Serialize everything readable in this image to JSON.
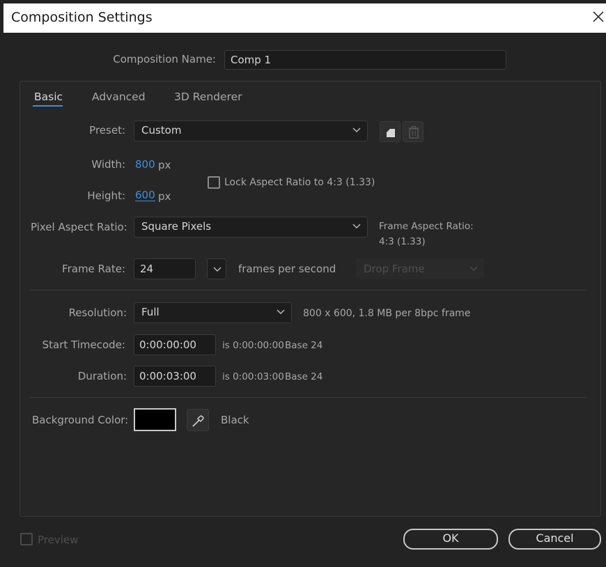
{
  "dialog": {
    "title": "Composition Settings"
  },
  "name": {
    "label": "Composition Name:",
    "value": "Comp 1"
  },
  "tabs": [
    {
      "label": "Basic",
      "active": true
    },
    {
      "label": "Advanced",
      "active": false
    },
    {
      "label": "3D Renderer",
      "active": false
    }
  ],
  "preset": {
    "label": "Preset:",
    "value": "Custom"
  },
  "width": {
    "label": "Width:",
    "value": "800",
    "unit": "px"
  },
  "height": {
    "label": "Height:",
    "value": "600",
    "unit": "px"
  },
  "lock_aspect": {
    "label": "Lock Aspect Ratio to 4:3 (1.33)",
    "checked": false
  },
  "pixel_aspect": {
    "label": "Pixel Aspect Ratio:",
    "value": "Square Pixels",
    "frame_aspect_label": "Frame Aspect Ratio:",
    "frame_aspect_value": "4:3 (1.33)"
  },
  "frame_rate": {
    "label": "Frame Rate:",
    "value": "24",
    "unit": "frames per second",
    "drop_frame": "Drop Frame"
  },
  "resolution": {
    "label": "Resolution:",
    "value": "Full",
    "info": "800 x 600, 1.8 MB per 8bpc frame"
  },
  "start_timecode": {
    "label": "Start Timecode:",
    "value": "0:00:00:00",
    "is_text": "is 0:00:00:00",
    "base": "Base 24"
  },
  "duration": {
    "label": "Duration:",
    "value": "0:00:03:00",
    "is_text": "is 0:00:03:00",
    "base": "Base 24"
  },
  "background": {
    "label": "Background Color:",
    "color_name": "Black",
    "swatch": "#000000"
  },
  "footer": {
    "preview_label": "Preview",
    "ok_label": "OK",
    "cancel_label": "Cancel"
  },
  "colors": {
    "accent": "#3a8fe0",
    "bg": "#232323"
  }
}
